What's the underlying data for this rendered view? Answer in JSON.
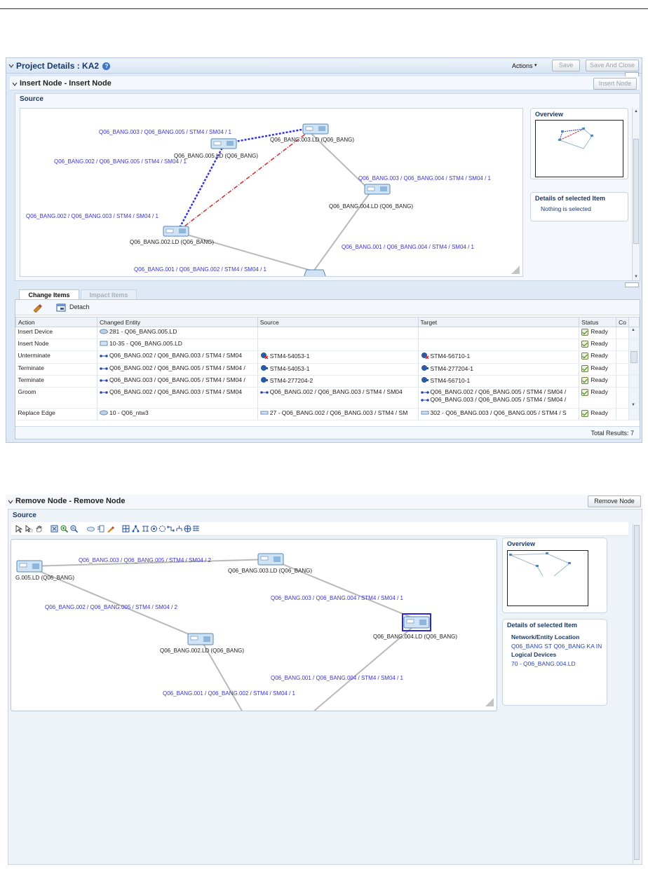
{
  "panel1": {
    "title": "Project Details : KA2",
    "help_icon": "?",
    "actions_label": "Actions",
    "save_label": "Save",
    "save_and_close_label": "Save And Close",
    "section_title": "Insert Node - Insert Node",
    "insert_node_button": "Insert Node",
    "source_label": "Source",
    "overview_title": "Overview",
    "details_title": "Details of selected Item",
    "details_text": "Nothing is selected",
    "graph": {
      "nodes": [
        {
          "id": "n005",
          "label": "Q06_BANG.005.LD (Q06_BANG)"
        },
        {
          "id": "n003",
          "label": "Q06_BANG.003.LD (Q06_BANG)"
        },
        {
          "id": "n004",
          "label": "Q06_BANG.004.LD (Q06_BANG)"
        },
        {
          "id": "n002",
          "label": "Q06_BANG.002.LD (Q06_BANG)"
        }
      ],
      "link_labels": [
        "Q06_BANG.003 / Q06_BANG.005 / STM4 / SM04 / 1",
        "Q06_BANG.002 / Q06_BANG.005 / STM4 / SM04 / 1",
        "Q06_BANG.003 / Q06_BANG.004 / STM4 / SM04 / 1",
        "Q06_BANG.002 / Q06_BANG.003 / STM4 / SM04 / 1",
        "Q06_BANG.001 / Q06_BANG.004 / STM4 / SM04 / 1",
        "Q06_BANG.001 / Q06_BANG.002 / STM4 / SM04 / 1"
      ]
    },
    "tabs": [
      "Change Items",
      "Impact Items"
    ],
    "detach_label": "Detach",
    "columns": [
      "Action",
      "Changed Entity",
      "Source",
      "Target",
      "Status",
      "Co"
    ],
    "rows": [
      {
        "action": "Insert Device",
        "entity": "281 - Q06_BANG.005.LD",
        "source": "",
        "target": "",
        "target2": "",
        "status": "Ready"
      },
      {
        "action": "Insert Node",
        "entity": "10-35 - Q06_BANG.005.LD",
        "source": "",
        "target": "",
        "target2": "",
        "status": "Ready"
      },
      {
        "action": "Unterminate",
        "entity": "Q06_BANG.002 / Q06_BANG.003 / STM4 / SM04",
        "source": "STM4-54053-1",
        "target": "STM4-56710-1",
        "target2": "",
        "status": "Ready"
      },
      {
        "action": "Terminate",
        "entity": "Q06_BANG.002 / Q06_BANG.005 / STM4 / SM04 /",
        "source": "STM4-54053-1",
        "target": "STM4-277204-1",
        "target2": "",
        "status": "Ready"
      },
      {
        "action": "Terminate",
        "entity": "Q06_BANG.003 / Q06_BANG.005 / STM4 / SM04 /",
        "source": "STM4-277204-2",
        "target": "STM4-56710-1",
        "target2": "",
        "status": "Ready"
      },
      {
        "action": "Groom",
        "entity": "Q06_BANG.002 / Q06_BANG.003 / STM4 / SM04",
        "source": "Q06_BANG.002 / Q06_BANG.003 / STM4 / SM04",
        "target": "Q06_BANG.002 / Q06_BANG.005 / STM4 / SM04 /",
        "target2": "Q06_BANG.003 / Q06_BANG.005 / STM4 / SM04 /",
        "status": "Ready"
      },
      {
        "action": "Replace Edge",
        "entity": "10 - Q06_ntw3",
        "source": "27 - Q06_BANG.002 / Q06_BANG.003 / STM4 / SM",
        "target": "302 - Q06_BANG.003 / Q06_BANG.005 / STM4 / S",
        "target2": "",
        "status": "Ready"
      }
    ],
    "total_results": "Total Results: 7"
  },
  "panel2": {
    "section_title": "Remove Node - Remove Node",
    "remove_node_button": "Remove Node",
    "source_label": "Source",
    "overview_title": "Overview",
    "details_title": "Details of selected Item",
    "location_label": "Network/Entity Location",
    "location_value": "Q06_BANG ST Q06_BANG KA IN",
    "logical_devices_label": "Logical Devices",
    "logical_devices_value": "70 - Q06_BANG.004.LD",
    "graph": {
      "nodes": [
        {
          "id": "n005",
          "label": "G.005.LD (Q06_BANG)"
        },
        {
          "id": "n003",
          "label": "Q06_BANG.003.LD (Q06_BANG)"
        },
        {
          "id": "n004",
          "label": "Q06_BANG.004.LD (Q06_BANG)"
        },
        {
          "id": "n002",
          "label": "Q06_BANG.002.LD (Q06_BANG)"
        }
      ],
      "link_labels": [
        "Q06_BANG.003 / Q06_BANG.005 / STM4 / SM04 / 2",
        "Q06_BANG.003 / Q06_BANG.004 / STM4 / SM04 / 1",
        "Q06_BANG.002 / Q06_BANG.005 / STM4 / SM04 / 2",
        "Q06_BANG.001 / Q06_BANG.004 / STM4 / SM04 / 1",
        "Q06_BANG.001 / Q06_BANG.002 / STM4 / SM04 / 1"
      ]
    }
  },
  "colors": {
    "link_text": "#3a35d0",
    "header_bg": "#dfe9f5",
    "dashed_blue": "#3232e6",
    "dashed_red": "#d42b2b",
    "link_gray": "#b9b9b9",
    "selected_node": "#2a2ad8"
  }
}
